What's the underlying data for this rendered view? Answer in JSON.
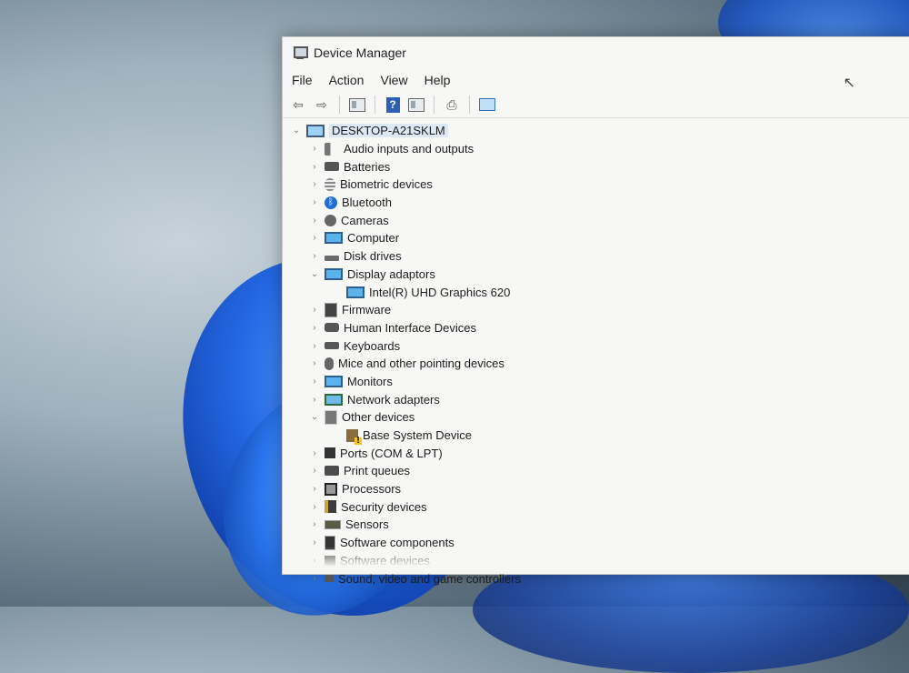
{
  "window": {
    "title": "Device Manager"
  },
  "menu": [
    "File",
    "Action",
    "View",
    "Help"
  ],
  "toolbar": [
    {
      "icon": "back-arrow-icon",
      "glyph": "⇦"
    },
    {
      "icon": "forward-arrow-icon",
      "glyph": "⇨"
    },
    {
      "sep": true
    },
    {
      "icon": "properties-icon",
      "shape": "sq"
    },
    {
      "sep": true
    },
    {
      "icon": "help-icon",
      "shape": "help",
      "glyph": "?"
    },
    {
      "icon": "show-hidden-icon",
      "shape": "sq"
    },
    {
      "sep": true
    },
    {
      "icon": "update-driver-icon",
      "glyph": "⎙"
    },
    {
      "sep": true
    },
    {
      "icon": "scan-hardware-icon",
      "shape": "scan"
    }
  ],
  "tree": [
    {
      "label": "DESKTOP-A21SKLM",
      "level": 0,
      "expanded": true,
      "icon": "i-computer",
      "root": true
    },
    {
      "label": "Audio inputs and outputs",
      "level": 1,
      "icon": "i-speaker"
    },
    {
      "label": "Batteries",
      "level": 1,
      "icon": "i-battery"
    },
    {
      "label": "Biometric devices",
      "level": 1,
      "icon": "i-bio"
    },
    {
      "label": "Bluetooth",
      "level": 1,
      "icon": "i-bt"
    },
    {
      "label": "Cameras",
      "level": 1,
      "icon": "i-cam"
    },
    {
      "label": "Computer",
      "level": 1,
      "icon": "i-mon"
    },
    {
      "label": "Disk drives",
      "level": 1,
      "icon": "i-disk"
    },
    {
      "label": "Display adaptors",
      "level": 1,
      "expanded": true,
      "icon": "i-mon"
    },
    {
      "label": "Intel(R) UHD Graphics 620",
      "level": 2,
      "leaf": true,
      "icon": "i-mon"
    },
    {
      "label": "Firmware",
      "level": 1,
      "icon": "i-fw"
    },
    {
      "label": "Human Interface Devices",
      "level": 1,
      "icon": "i-hid"
    },
    {
      "label": "Keyboards",
      "level": 1,
      "icon": "i-kb"
    },
    {
      "label": "Mice and other pointing devices",
      "level": 1,
      "icon": "i-mouse"
    },
    {
      "label": "Monitors",
      "level": 1,
      "icon": "i-mon"
    },
    {
      "label": "Network adapters",
      "level": 1,
      "icon": "i-net"
    },
    {
      "label": "Other devices",
      "level": 1,
      "expanded": true,
      "icon": "i-other"
    },
    {
      "label": "Base System Device",
      "level": 2,
      "leaf": true,
      "icon": "i-warn"
    },
    {
      "label": "Ports (COM & LPT)",
      "level": 1,
      "icon": "i-port"
    },
    {
      "label": "Print queues",
      "level": 1,
      "icon": "i-print"
    },
    {
      "label": "Processors",
      "level": 1,
      "icon": "i-cpu"
    },
    {
      "label": "Security devices",
      "level": 1,
      "icon": "i-sec"
    },
    {
      "label": "Sensors",
      "level": 1,
      "icon": "i-sensor"
    },
    {
      "label": "Software components",
      "level": 1,
      "icon": "i-sw"
    },
    {
      "label": "Software devices",
      "level": 1,
      "icon": "i-swd"
    },
    {
      "label": "Sound, video and game controllers",
      "level": 1,
      "icon": "i-sound"
    }
  ]
}
